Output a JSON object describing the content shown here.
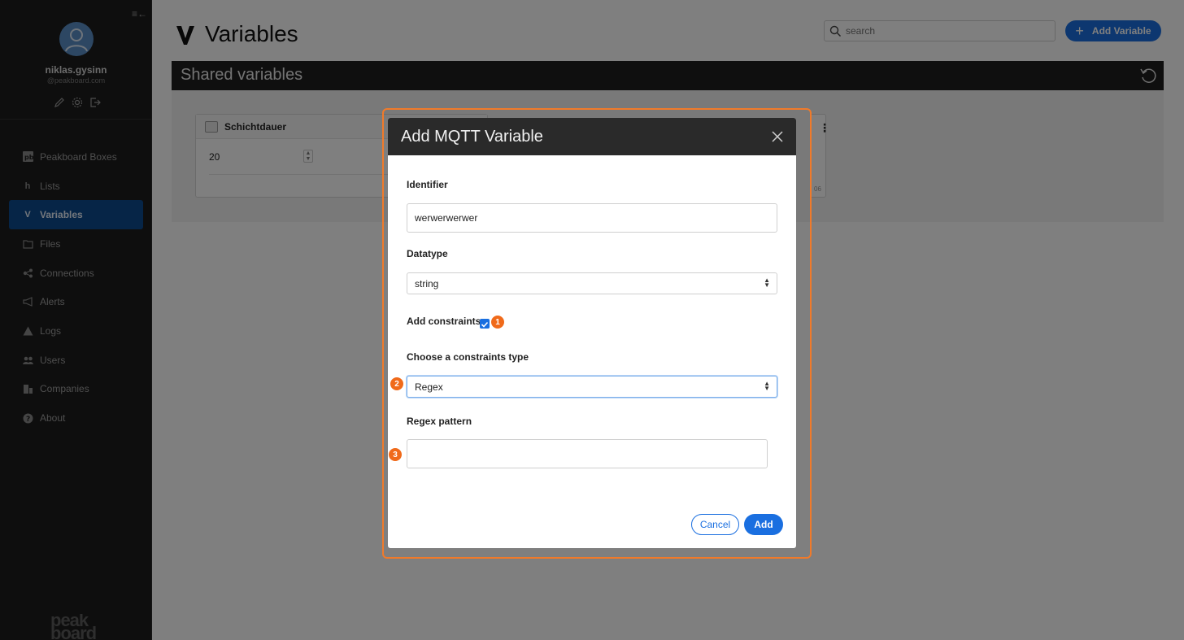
{
  "sidebar": {
    "user": {
      "name": "niklas.gysinn",
      "domain": "@peakboard.com"
    },
    "items": [
      {
        "label": "Peakboard Boxes",
        "icon": "pb-box-icon"
      },
      {
        "label": "Lists",
        "icon": "lists-icon"
      },
      {
        "label": "Variables",
        "icon": "variables-icon",
        "active": true
      },
      {
        "label": "Files",
        "icon": "files-icon"
      },
      {
        "label": "Connections",
        "icon": "connections-icon"
      },
      {
        "label": "Alerts",
        "icon": "megaphone-icon"
      },
      {
        "label": "Logs",
        "icon": "warning-icon"
      },
      {
        "label": "Users",
        "icon": "users-icon"
      },
      {
        "label": "Companies",
        "icon": "companies-icon"
      },
      {
        "label": "About",
        "icon": "help-icon"
      }
    ],
    "logo_text": "peak board"
  },
  "header": {
    "title": "Variables",
    "search_placeholder": "search",
    "add_button_label": "Add Variable"
  },
  "shared": {
    "title": "Shared variables",
    "card": {
      "name": "Schichtdauer",
      "value": "20"
    },
    "card2_small": "06"
  },
  "modal": {
    "title": "Add MQTT Variable",
    "identifier_label": "Identifier",
    "identifier_value": "werwerwerwer",
    "datatype_label": "Datatype",
    "datatype_value": "string",
    "constraints_label": "Add constraints",
    "constraints_checked": true,
    "constraints_type_label": "Choose a constraints type",
    "constraints_type_value": "Regex",
    "regex_label": "Regex pattern",
    "regex_value": "",
    "cancel_label": "Cancel",
    "add_label": "Add"
  },
  "annotations": [
    "1",
    "2",
    "3"
  ],
  "colors": {
    "accent": "#1a6fe0",
    "highlight": "#f07a2a",
    "sidebar_bg": "#1c1c1c",
    "active_nav": "#0d4a8f"
  }
}
